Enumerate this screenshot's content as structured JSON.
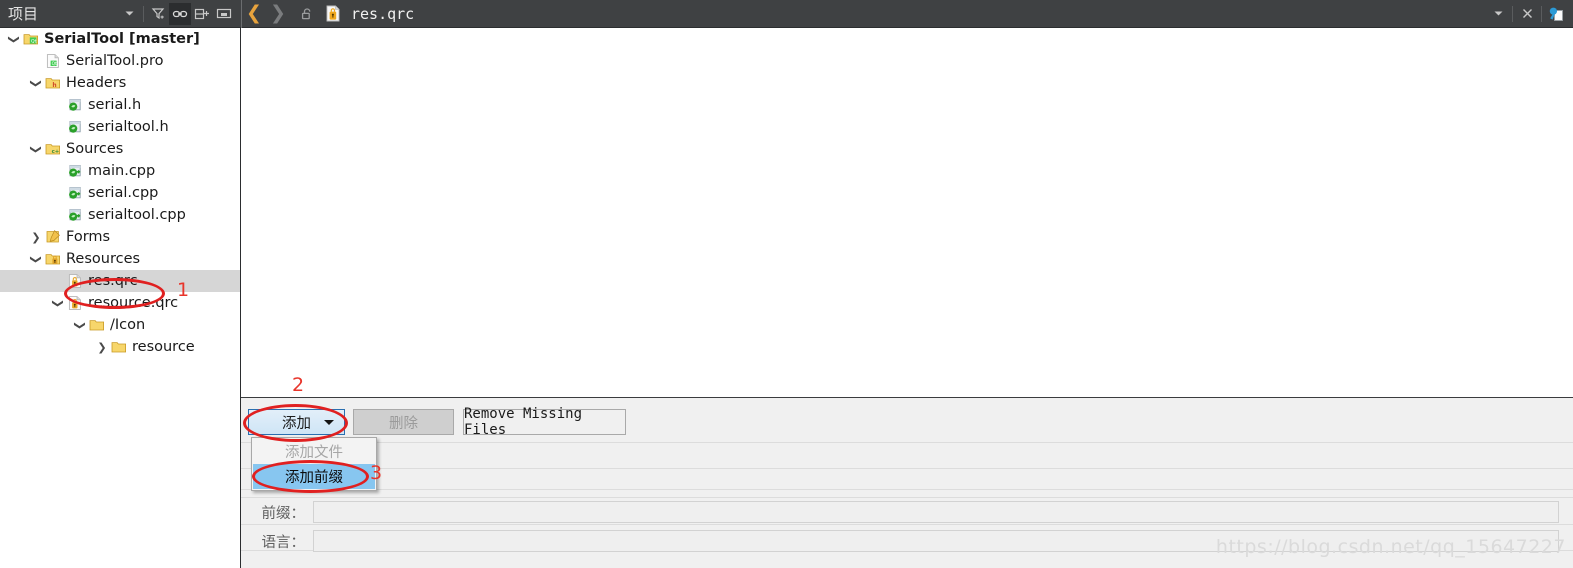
{
  "toolbar": {
    "project_label": "项目",
    "dropdown_icon": "chevron-down-icon",
    "filter_icon": "filter-icon",
    "link_icon": "link-sync-icon",
    "split_icon": "split-add-icon",
    "collapse_icon": "minimize-icon",
    "back_icon": "back-chevron-icon",
    "forward_icon": "forward-chevron-icon",
    "unlock_icon": "unlock-icon",
    "file_icon": "qrc-file-icon",
    "tab_title": "res.qrc",
    "tab_dropdown_icon": "chevron-down-icon",
    "close_icon": "close-x-icon",
    "split_view_icon": "split-view-icon"
  },
  "tree": {
    "items": [
      {
        "label": "SerialTool [master]",
        "indent": 0,
        "arrow": "expanded",
        "icon": "qt-folder-icon",
        "bold": true,
        "selected": false
      },
      {
        "label": "SerialTool.pro",
        "indent": 1,
        "arrow": "none",
        "icon": "qt-pro-file-icon",
        "bold": false,
        "selected": false
      },
      {
        "label": "Headers",
        "indent": 1,
        "arrow": "expanded",
        "icon": "headers-folder-icon",
        "bold": false,
        "selected": false
      },
      {
        "label": "serial.h",
        "indent": 2,
        "arrow": "none",
        "icon": "header-file-icon",
        "bold": false,
        "selected": false
      },
      {
        "label": "serialtool.h",
        "indent": 2,
        "arrow": "none",
        "icon": "header-file-icon",
        "bold": false,
        "selected": false
      },
      {
        "label": "Sources",
        "indent": 1,
        "arrow": "expanded",
        "icon": "sources-folder-icon",
        "bold": false,
        "selected": false
      },
      {
        "label": "main.cpp",
        "indent": 2,
        "arrow": "none",
        "icon": "cpp-file-icon",
        "bold": false,
        "selected": false
      },
      {
        "label": "serial.cpp",
        "indent": 2,
        "arrow": "none",
        "icon": "cpp-file-icon",
        "bold": false,
        "selected": false
      },
      {
        "label": "serialtool.cpp",
        "indent": 2,
        "arrow": "none",
        "icon": "cpp-file-icon",
        "bold": false,
        "selected": false
      },
      {
        "label": "Forms",
        "indent": 1,
        "arrow": "collapsed",
        "icon": "forms-folder-icon",
        "bold": false,
        "selected": false
      },
      {
        "label": "Resources",
        "indent": 1,
        "arrow": "expanded",
        "icon": "resources-folder-icon",
        "bold": false,
        "selected": false
      },
      {
        "label": "res.qrc",
        "indent": 2,
        "arrow": "none",
        "icon": "qrc-file-icon",
        "bold": false,
        "selected": true
      },
      {
        "label": "resource.qrc",
        "indent": 2,
        "arrow": "expanded",
        "icon": "qrc-file-icon",
        "bold": false,
        "selected": false
      },
      {
        "label": "/Icon",
        "indent": 3,
        "arrow": "expanded",
        "icon": "folder-icon",
        "bold": false,
        "selected": false
      },
      {
        "label": "resource",
        "indent": 4,
        "arrow": "collapsed",
        "icon": "folder-icon",
        "bold": false,
        "selected": false
      }
    ]
  },
  "resource_editor": {
    "buttons": {
      "add": "添加",
      "remove": "删除",
      "remove_missing": "Remove Missing Files"
    },
    "menu": {
      "add_file": "添加文件",
      "add_prefix": "添加前缀"
    },
    "fields": [
      {
        "label": "前缀：",
        "value": ""
      },
      {
        "label": "语言：",
        "value": ""
      }
    ]
  },
  "annotations": {
    "markers": [
      "1",
      "2",
      "3"
    ],
    "color": "#e8352b"
  },
  "watermark": {
    "text": "https://blog.csdn.net/qq_15647227"
  }
}
